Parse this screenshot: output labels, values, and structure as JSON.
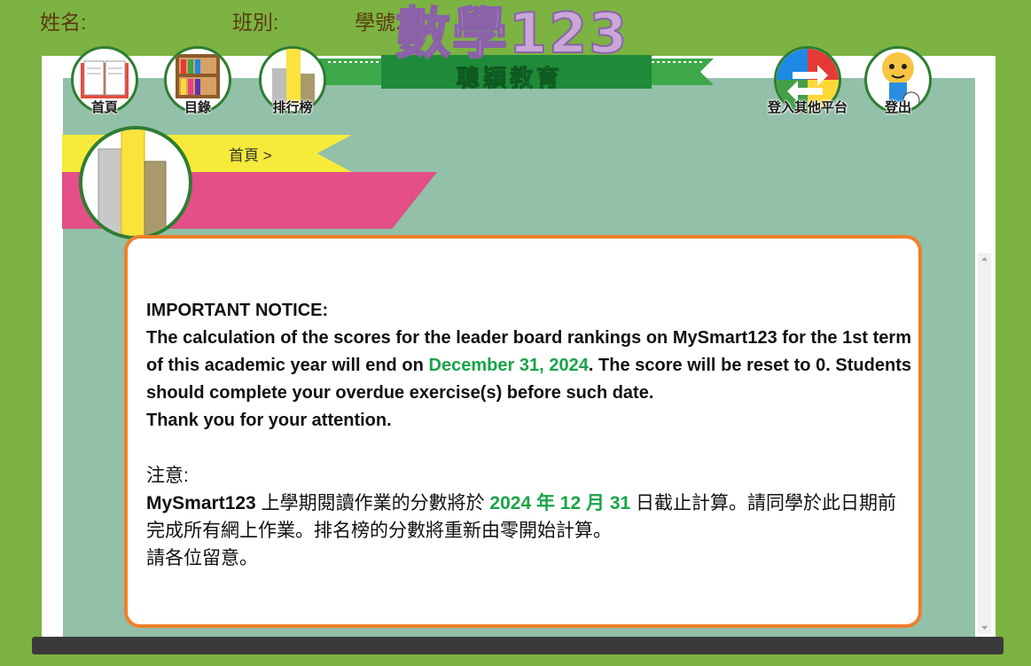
{
  "header": {
    "name_label": "姓名:",
    "class_label": "班別:",
    "student_no_label": "學號: 01"
  },
  "logo": {
    "title": "數學123",
    "subtitle": "聰穎教育"
  },
  "nav": {
    "home": "首頁",
    "catalog": "目錄",
    "ranking": "排行榜",
    "other_platforms": "登入其他平台",
    "logout": "登出"
  },
  "breadcrumb": "首頁 >",
  "notice": {
    "heading": "IMPORTANT NOTICE:",
    "en_part1": "The calculation of the scores for the leader board rankings on MySmart123 for the 1st term of this academic year will end on ",
    "en_date": "December 31, 2024",
    "en_part2": ". The score will be reset to 0. Students should complete your overdue exercise(s) before such date.",
    "en_thanks": "Thank you for your attention.",
    "zh_heading": "注意:",
    "zh_brand": "MySmart123",
    "zh_part1": " 上學期閱讀作業的分數將於 ",
    "zh_date": "2024 年 12 月 31",
    "zh_part2": " 日截止計算。請同學於此日期前完成所有網上作業。排名榜的分數將重新由零開始計算。",
    "zh_thanks": "請各位留意。"
  },
  "colors": {
    "background": "#7cb342",
    "board": "#92c0a8",
    "notice_border": "#f07f2c",
    "highlight_green": "#1aa34a",
    "banner_yellow": "#f6ea3a",
    "banner_pink": "#e34f86"
  },
  "icons": [
    "book-icon",
    "bookshelf-icon",
    "podium-icon",
    "switch-platform-icon",
    "tiger-mascot-icon"
  ]
}
